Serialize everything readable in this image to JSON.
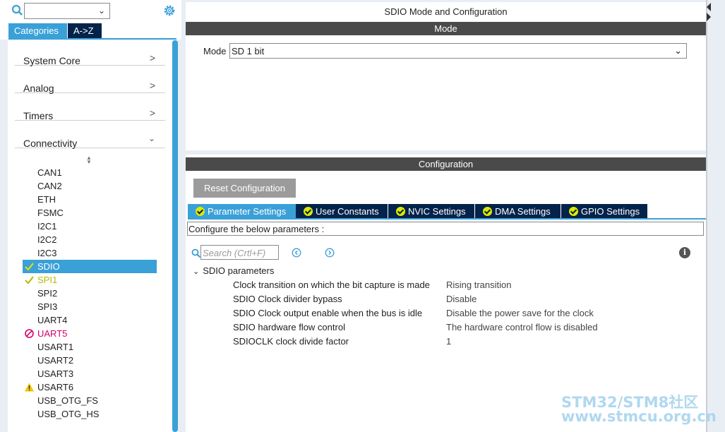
{
  "left": {
    "category_select_value": "",
    "tabs": [
      {
        "label": "Categories"
      },
      {
        "label": "A->Z"
      }
    ],
    "categories": [
      {
        "label": "System Core",
        "arrow": ">"
      },
      {
        "label": "Analog",
        "arrow": ">"
      },
      {
        "label": "Timers",
        "arrow": ">"
      },
      {
        "label": "Connectivity",
        "arrow": "v"
      }
    ],
    "peripherals": [
      {
        "label": "CAN1",
        "status": "none"
      },
      {
        "label": "CAN2",
        "status": "none"
      },
      {
        "label": "ETH",
        "status": "none"
      },
      {
        "label": "FSMC",
        "status": "none"
      },
      {
        "label": "I2C1",
        "status": "none"
      },
      {
        "label": "I2C2",
        "status": "none"
      },
      {
        "label": "I2C3",
        "status": "none"
      },
      {
        "label": "SDIO",
        "status": "selected"
      },
      {
        "label": "SPI1",
        "status": "ok"
      },
      {
        "label": "SPI2",
        "status": "none"
      },
      {
        "label": "SPI3",
        "status": "none"
      },
      {
        "label": "UART4",
        "status": "none"
      },
      {
        "label": "UART5",
        "status": "error"
      },
      {
        "label": "USART1",
        "status": "none"
      },
      {
        "label": "USART2",
        "status": "none"
      },
      {
        "label": "USART3",
        "status": "none"
      },
      {
        "label": "USART6",
        "status": "warning"
      },
      {
        "label": "USB_OTG_FS",
        "status": "none"
      },
      {
        "label": "USB_OTG_HS",
        "status": "none"
      }
    ],
    "accent_color": "#3aa0d8",
    "dark_color": "#03234b"
  },
  "mode_panel": {
    "title": "SDIO Mode and Configuration",
    "section": "Mode",
    "mode_label": "Mode",
    "mode_value": "SD 1 bit"
  },
  "config_panel": {
    "section": "Configuration",
    "reset_label": "Reset Configuration",
    "tabs": [
      {
        "label": "Parameter Settings",
        "active": true
      },
      {
        "label": "User Constants",
        "active": false
      },
      {
        "label": "NVIC Settings",
        "active": false
      },
      {
        "label": "DMA Settings",
        "active": false
      },
      {
        "label": "GPIO Settings",
        "active": false
      }
    ],
    "description": "Configure the below parameters :",
    "search_placeholder": "Search (Crtl+F)",
    "group_label": "SDIO parameters",
    "params": [
      {
        "key": "Clock transition on which the bit capture is made",
        "value": "Rising transition"
      },
      {
        "key": "SDIO Clock divider bypass",
        "value": "Disable"
      },
      {
        "key": "SDIO Clock output enable when the bus is idle",
        "value": "Disable the power save for the clock"
      },
      {
        "key": "SDIO hardware flow control",
        "value": "The hardware control flow is disabled"
      },
      {
        "key": "SDIOCLK clock divide factor",
        "value": "1"
      }
    ]
  },
  "watermark": {
    "line1": "STM32/STM8社区",
    "line2": "www.stmcu.org.cn"
  }
}
